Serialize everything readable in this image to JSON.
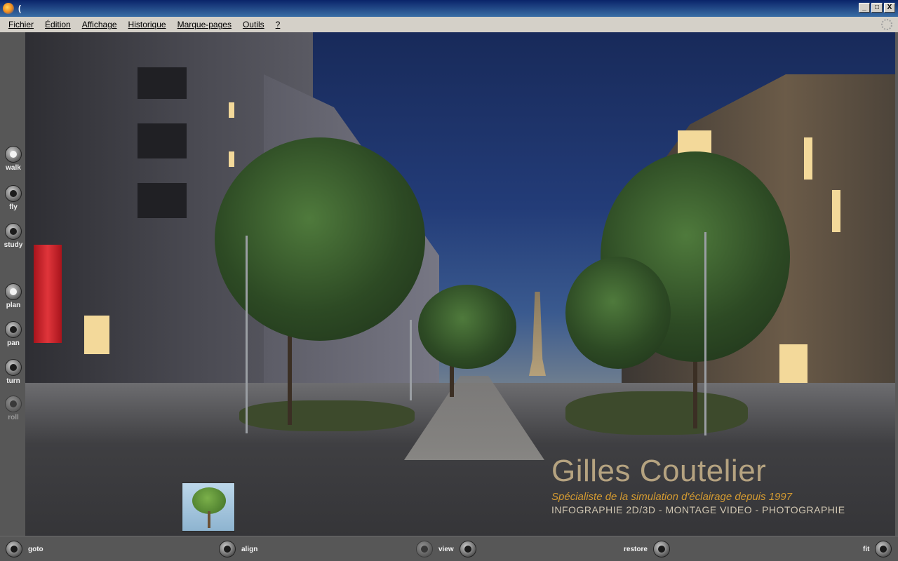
{
  "titlebar": {
    "title": "(",
    "buttons": {
      "minimize": "_",
      "maximize": "□",
      "close": "X"
    }
  },
  "menubar": {
    "items": [
      "Fichier",
      "Édition",
      "Affichage",
      "Historique",
      "Marque-pages",
      "Outils",
      "?"
    ]
  },
  "viewer": {
    "nav_buttons": [
      {
        "label": "walk",
        "icon": "walk-icon",
        "enabled": true
      },
      {
        "label": "fly",
        "icon": "fly-icon",
        "enabled": true
      },
      {
        "label": "study",
        "icon": "study-icon",
        "enabled": true
      },
      {
        "label": "plan",
        "icon": "plan-icon",
        "enabled": true
      },
      {
        "label": "pan",
        "icon": "pan-icon",
        "enabled": true
      },
      {
        "label": "turn",
        "icon": "turn-icon",
        "enabled": true
      },
      {
        "label": "roll",
        "icon": "roll-icon",
        "enabled": false
      }
    ],
    "bottom_buttons": {
      "goto": "goto",
      "align": "align",
      "view": "view",
      "restore": "restore",
      "fit": "fit"
    },
    "watermark": {
      "name": "Gilles Coutelier",
      "tagline": "Spécialiste de la simulation d'éclairage depuis 1997",
      "services": "INFOGRAPHIE 2D/3D - MONTAGE VIDEO - PHOTOGRAPHIE"
    },
    "colors": {
      "frame": "#575757",
      "sky": "#233c78",
      "tagline": "#d39a31"
    }
  }
}
